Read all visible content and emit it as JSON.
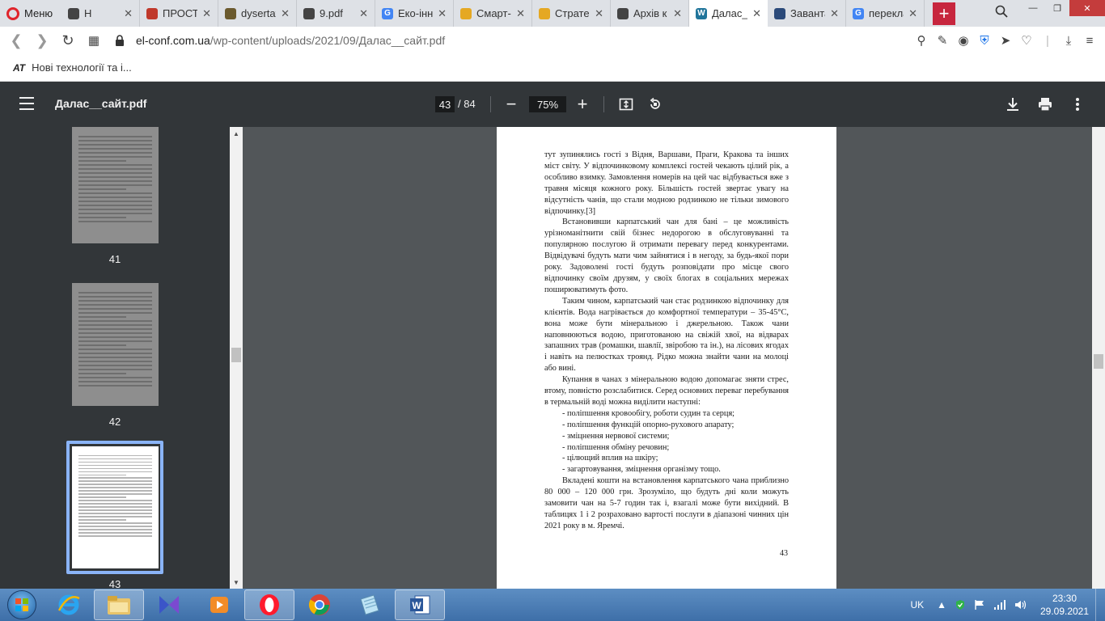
{
  "browser": {
    "menu_label": "Меню",
    "tabs": [
      {
        "title": "Н",
        "color": "#444444",
        "letter": ""
      },
      {
        "title": "ПРОСТО",
        "color": "#c0392b",
        "letter": ""
      },
      {
        "title": "dysertat",
        "color": "#6b5a2e",
        "letter": ""
      },
      {
        "title": "9.pdf",
        "color": "#444444",
        "letter": ""
      },
      {
        "title": "Еко-інн",
        "color": "#4285f4",
        "letter": "G"
      },
      {
        "title": "Смарт-с",
        "color": "#e5a823",
        "letter": ""
      },
      {
        "title": "Страте",
        "color": "#e5a823",
        "letter": ""
      },
      {
        "title": "Архів к",
        "color": "#444444",
        "letter": ""
      },
      {
        "title": "Далас_",
        "color": "#21759b",
        "letter": "W"
      },
      {
        "title": "Заванта",
        "color": "#2b4a7a",
        "letter": ""
      },
      {
        "title": "перекла",
        "color": "#4285f4",
        "letter": "G"
      }
    ],
    "url_host": "el-conf.com.ua",
    "url_path": "/wp-content/uploads/2021/09/Далас__сайт.pdf",
    "bookmark_label": "Нові технології та і...",
    "bookmark_icon": "AT"
  },
  "pdf": {
    "title": "Далас__сайт.pdf",
    "current_page": "43",
    "total_pages": "/ 84",
    "zoom": "75%"
  },
  "thumbnails": [
    {
      "number": "41"
    },
    {
      "number": "42"
    },
    {
      "number": "43"
    }
  ],
  "page": {
    "paragraphs": [
      {
        "style": "plain",
        "text": "тут зупинялись гості з Відня, Варшави, Праги, Кракова та інших міст світу. У відпочинковому комплексі гостей чекають цілий рік, а особливо взимку. Замовлення номерів на цей час відбувається вже з травня місяця кожного року. Більшість гостей звертає увагу на відсутність чанів, що стали модною родзинкою не тільки зимового відпочинку.[3]"
      },
      {
        "style": "ind",
        "text": "Встановивши карпатський чан для бані – це можливість урізноманітнити свій бізнес недорогою в обслуговуванні та популярною послугою й отримати перевагу перед конкурентами. Відвідувачі будуть мати чим зайнятися і в негоду, за будь-якої пори року. Задоволені гості будуть розповідати про місце свого відпочинку своїм друзям, у своїх блогах в соціальних мережах поширюватимуть фото."
      },
      {
        "style": "ind",
        "text": "Таким чином, карпатський чан стає родзинкою відпочинку для клієнтів. Вода нагрівається до комфортної температури – 35-45°С, вона може бути мінеральною і джерельною. Також чани наповнюються водою, приготованою на свіжій хвої, на відварах запашних трав (ромашки, шавлії, звіробою та ін.), на лісових ягодах і навіть на пелюстках троянд. Рідко можна знайти чани на молоці або вині."
      },
      {
        "style": "ind",
        "text": "Купання в чанах з мінеральною водою допомагає зняти стрес, втому, повністю розслабитися. Серед основних переваг перебування в термальній воді можна виділити наступні:"
      },
      {
        "style": "li",
        "text": "- поліпшення кровообігу, роботи судин та серця;"
      },
      {
        "style": "li",
        "text": "- поліпшення функцій опорно-рухового апарату;"
      },
      {
        "style": "li",
        "text": "- зміцнення нервової системи;"
      },
      {
        "style": "li",
        "text": "- поліпшення обміну речовин;"
      },
      {
        "style": "li",
        "text": "- цілющий вплив на шкіру;"
      },
      {
        "style": "li",
        "text": "- загартовування, зміцнення організму тощо."
      },
      {
        "style": "ind",
        "text": "Вкладені кошти на встановлення карпатського чана приблизно 80 000 – 120 000 грн. Зрозуміло, що будуть дні коли можуть замовити чан на 5-7 годин так і, взагалі може бути вихідний. В таблицях 1 і 2 розраховано вартості послуги в діапазоні чинних цін 2021 року в м. Яремчі."
      }
    ],
    "page_number": "43"
  },
  "taskbar": {
    "language": "UK",
    "time": "23:30",
    "date": "29.09.2021"
  }
}
